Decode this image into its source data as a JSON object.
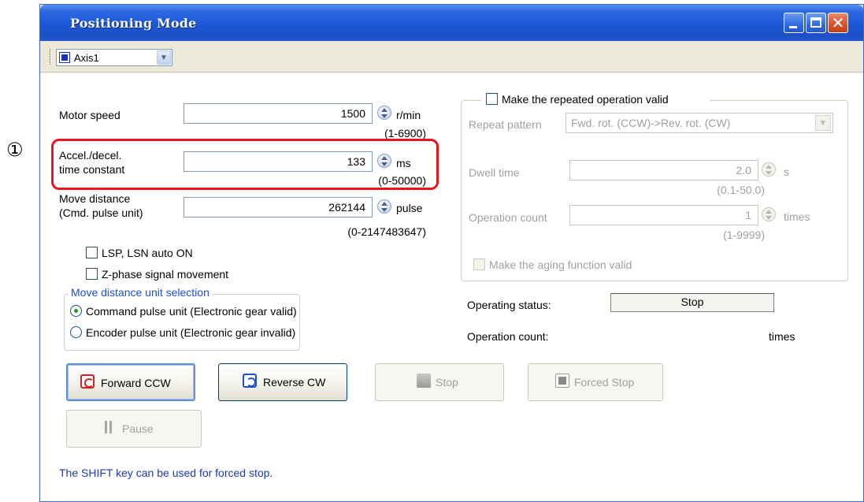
{
  "annotation": {
    "number": "①"
  },
  "window": {
    "title": "Positioning Mode"
  },
  "toolbar": {
    "axis_value": "Axis1"
  },
  "left": {
    "motor_speed": {
      "label": "Motor speed",
      "value": "1500",
      "unit": "r/min",
      "range": "(1-6900)"
    },
    "accel": {
      "label_line1": "Accel./decel.",
      "label_line2": "time constant",
      "value": "133",
      "unit": "ms",
      "range": "(0-50000)"
    },
    "move_distance": {
      "label_line1": "Move distance",
      "label_line2": "(Cmd. pulse unit)",
      "value": "262144",
      "unit": "pulse",
      "range": "(0-2147483647)"
    },
    "lsp_lsn": {
      "label": "LSP, LSN auto ON",
      "checked": false
    },
    "z_phase": {
      "label": "Z-phase signal movement",
      "checked": false
    },
    "unit_group": {
      "title": "Move distance unit selection",
      "options": [
        {
          "label": "Command pulse unit (Electronic gear valid)",
          "selected": true
        },
        {
          "label": "Encoder pulse unit (Electronic gear invalid)",
          "selected": false
        }
      ]
    }
  },
  "right": {
    "repeat_valid": {
      "label": "Make the repeated operation valid",
      "checked": false
    },
    "repeat_pattern": {
      "label": "Repeat pattern",
      "value": "Fwd. rot. (CCW)->Rev. rot. (CW)"
    },
    "dwell": {
      "label": "Dwell time",
      "value": "2.0",
      "unit": "s",
      "range": "(0.1-50.0)"
    },
    "op_count": {
      "label": "Operation count",
      "value": "1",
      "unit": "times",
      "range": "(1-9999)"
    },
    "aging": {
      "label": "Make the aging function valid",
      "checked": false
    }
  },
  "status": {
    "operating_label": "Operating status:",
    "operating_value": "Stop",
    "count_label": "Operation count:",
    "count_unit": "times"
  },
  "buttons": {
    "forward": "Forward CCW",
    "reverse": "Reverse CW",
    "stop": "Stop",
    "forced_stop": "Forced Stop",
    "pause": "Pause"
  },
  "hint": "The SHIFT key can be used for forced stop.",
  "colors": {
    "title_bar": "#1b56d6",
    "highlight_box": "#e8141e",
    "group_title": "#1e4fd1",
    "hint_text": "#1e3aa8"
  }
}
